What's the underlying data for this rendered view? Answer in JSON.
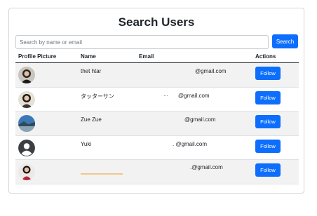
{
  "page": {
    "title": "Search Users"
  },
  "search": {
    "placeholder": "Search by name or email",
    "value": "",
    "button_label": "Search"
  },
  "table": {
    "headers": {
      "picture": "Profile Picture",
      "name": "Name",
      "email": "Email",
      "actions": "Actions"
    },
    "rows": [
      {
        "name": "thet htar",
        "email": "@gmail.com",
        "avatar": "woman-photo-avatar",
        "action_label": "Follow"
      },
      {
        "name": "タッターサン",
        "email": "@gmail.com",
        "avatar": "woman-photo-avatar",
        "action_label": "Follow"
      },
      {
        "name": "Zue Zue",
        "email": "@gmail.com",
        "avatar": "landscape-photo-avatar",
        "action_label": "Follow"
      },
      {
        "name": "Yuki",
        "email": ". @gmail.com",
        "avatar": "default-person-avatar",
        "action_label": "Follow"
      },
      {
        "name": "",
        "email": ".@gmail.com",
        "avatar": "woman-photo-avatar",
        "action_label": "Follow"
      }
    ]
  },
  "colors": {
    "primary": "#0d6efd",
    "stripe": "#f2f2f2",
    "border": "#dee2e6"
  }
}
